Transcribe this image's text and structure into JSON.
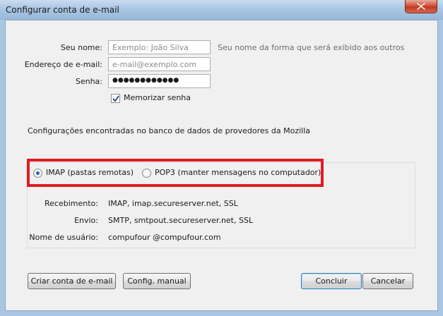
{
  "window": {
    "title": "Configurar conta de e-mail"
  },
  "form": {
    "name_label": "Seu nome:",
    "name_placeholder": "Exemplo: João Silva",
    "name_hint": "Seu nome da forma que será exibido aos outros",
    "email_label": "Endereço de e-mail:",
    "email_placeholder": "e-mail@exemplo.com",
    "password_label": "Senha:",
    "password_value": "●●●●●●●●●●●●",
    "remember_label": "Memorizar senha",
    "remember_checked": true
  },
  "config_found_text": "Configurações encontradas no banco de dados de provedores da Mozilla",
  "protocol": {
    "imap_label": "IMAP (pastas remotas)",
    "pop3_label": "POP3 (manter mensagens no computador)",
    "selected": "IMAP"
  },
  "details": {
    "incoming_label": "Recebimento:",
    "incoming_value": "IMAP, imap.secureserver.net, SSL",
    "outgoing_label": "Envio:",
    "outgoing_value": "SMTP, smtpout.secureserver.net, SSL",
    "username_label": "Nome de usuário:",
    "username_value": "compufour @compufour.com"
  },
  "buttons": {
    "create_account": "Criar conta de e-mail",
    "manual_config": "Config. manual",
    "done": "Concluir",
    "cancel": "Cancelar"
  },
  "colors": {
    "highlight_border": "#e21b23",
    "radio_selected": "#2a63b8",
    "titlebar": "#a9c6e3",
    "close_button": "#c23a22"
  }
}
